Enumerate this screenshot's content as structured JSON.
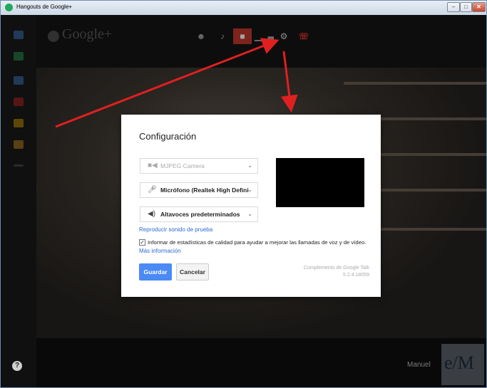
{
  "window": {
    "title": "Hangouts de Google+",
    "controls": {
      "minimize": "–",
      "maximize": "□",
      "close": "✕"
    }
  },
  "sidebar": {
    "icons": [
      {
        "name": "chat-icon",
        "color": "#4a90e2"
      },
      {
        "name": "screenshare-icon",
        "color": "#2db35e"
      },
      {
        "name": "camera-icon",
        "color": "#4a90e2"
      },
      {
        "name": "youtube-icon",
        "color": "#e02a2a"
      },
      {
        "name": "drive-icon",
        "color": "#f2b400"
      },
      {
        "name": "effects-icon",
        "color": "#e8a020"
      },
      {
        "name": "more-icon",
        "color": "#666666"
      }
    ],
    "help_label": "?"
  },
  "topbar": {
    "logo": "Google+",
    "toolbar_icons": [
      "add-person-icon",
      "mic-muted-icon",
      "camera-off-icon",
      "signal-icon",
      "settings-icon",
      "hang-up-icon"
    ]
  },
  "dialog": {
    "title": "Configuración",
    "camera": {
      "value": "MJPEG Camera",
      "enabled": false
    },
    "microphone": {
      "value": "Micrófono (Realtek High Defini..."
    },
    "speakers": {
      "value": "Altavoces predeterminados"
    },
    "test_sound_link": "Reproducir sonido de prueba",
    "stats_checkbox": {
      "checked": true,
      "label": "Informar de estadísticas de calidad para ayudar a mejorar las llamadas de voz y de vídeo."
    },
    "more_info_link": "Más información",
    "save_label": "Guardar",
    "cancel_label": "Cancelar",
    "plugin_name": "Complemento de Google Talk",
    "plugin_version": "5.2.4.18059"
  },
  "self_view": {
    "name": "Manuel"
  },
  "colors": {
    "accent": "#4a8af4",
    "annotation_arrow": "#e02020",
    "active_toggle": "#c0392b"
  }
}
